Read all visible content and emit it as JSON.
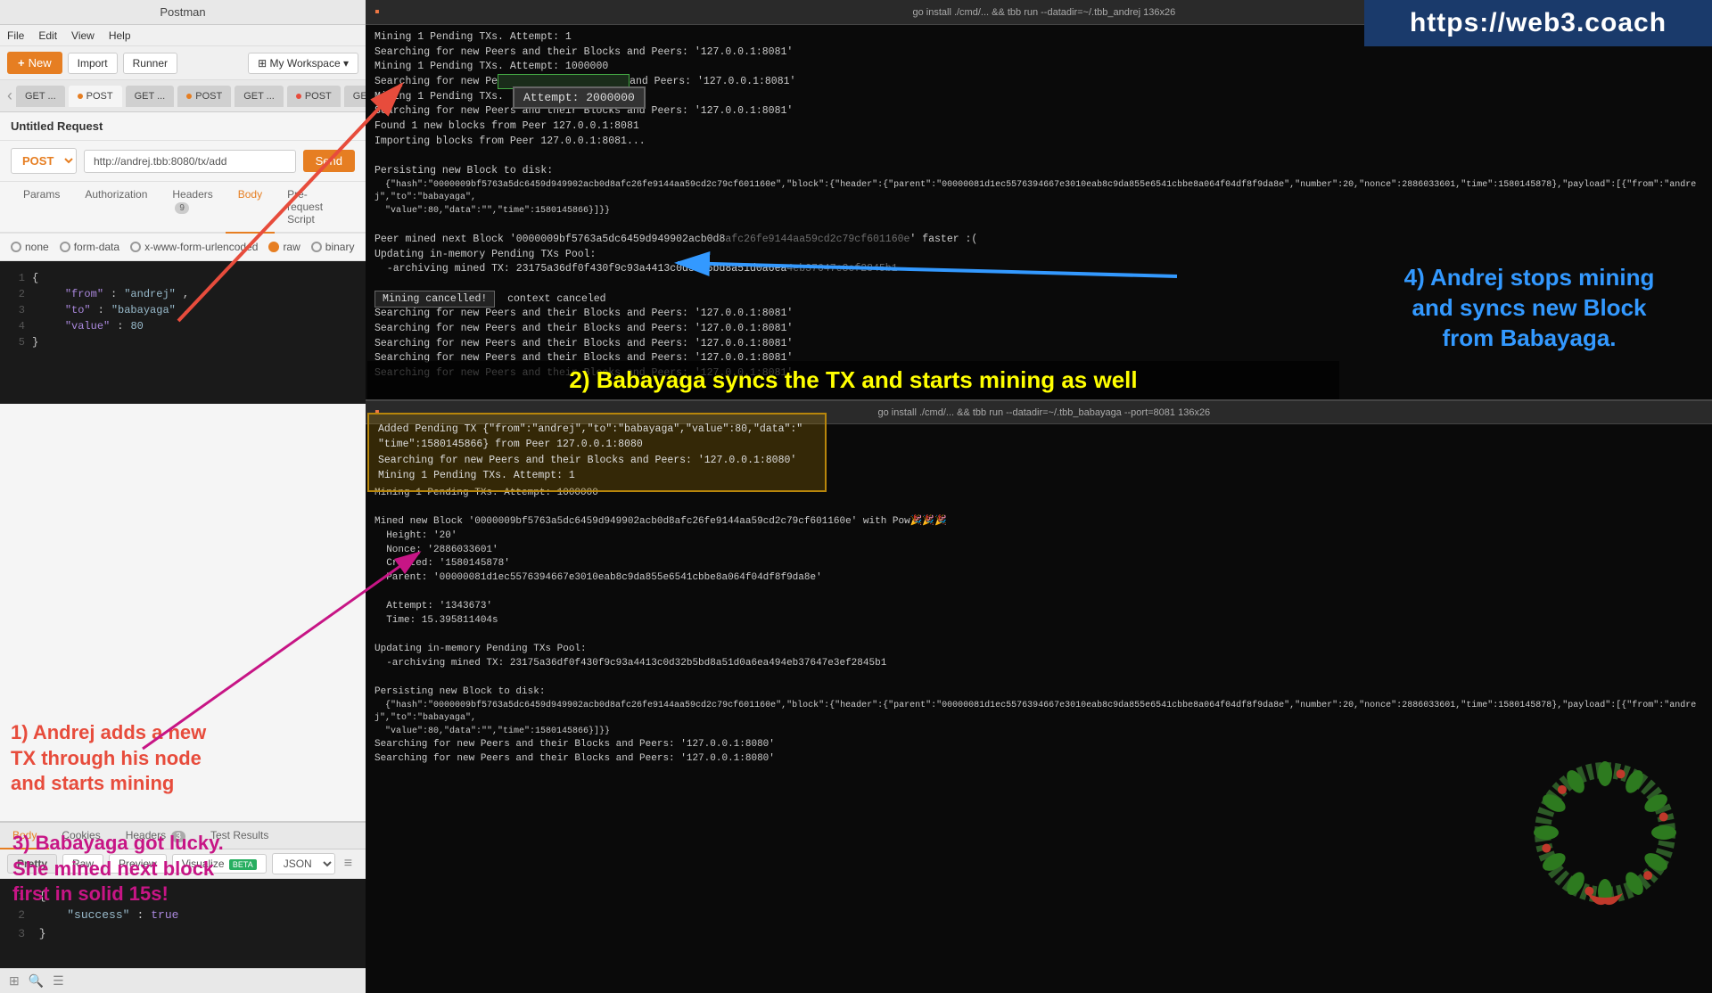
{
  "postman": {
    "titlebar": "Postman",
    "menu": [
      "File",
      "Edit",
      "View",
      "Help"
    ],
    "toolbar": {
      "new_label": "New",
      "import_label": "Import",
      "runner_label": "Runner",
      "workspace_label": "My Workspace"
    },
    "tabs": [
      {
        "label": "GET ...",
        "dot": "none"
      },
      {
        "label": "POST",
        "dot": "orange"
      },
      {
        "label": "GET ...",
        "dot": "none"
      },
      {
        "label": "POST",
        "dot": "orange"
      },
      {
        "label": "GET ...",
        "dot": "none"
      },
      {
        "label": "POST",
        "dot": "orange"
      },
      {
        "label": "GET ...",
        "dot": "none"
      }
    ],
    "request": {
      "title": "Untitled Request",
      "method": "POST",
      "url": "http://andrej.tbb:8080/tx/add",
      "subtabs": [
        "Params",
        "Authorization",
        "Headers (9)",
        "Body",
        "Pre-request Script"
      ],
      "body_options": [
        "none",
        "form-data",
        "x-www-form-urlencoded",
        "raw",
        "binary"
      ],
      "selected_body_option": "raw",
      "body_code": [
        "1  {",
        "2      \"from\": \"andrej\",",
        "3      \"to\": \"babayaga\",",
        "4      \"value\": 80",
        "5  }"
      ]
    },
    "response": {
      "tabs": [
        "Body",
        "Cookies",
        "Headers (3)",
        "Test Results"
      ],
      "toolbar_btns": [
        "Pretty",
        "Raw",
        "Preview",
        "Visualize BETA"
      ],
      "format": "JSON",
      "code": [
        "1  {",
        "2      \"success\": true",
        "3  }"
      ]
    }
  },
  "terminal_top": {
    "titlebar": "go install ./cmd/... && tbb run --datadir=~/.tbb_andrej 136x26",
    "content_lines": [
      "Mining 1 Pending TXs. Attempt: 1",
      "Searching for new Peers and their Blocks and Peers: '127.0.0.1:8081'",
      "Mining 1 Pending TXs. Attempt: 1000000",
      "Searching for new Peers and their Blocks and Peers: '127.0.0.1:8081'",
      "Mining 1 Pending TXs. Attempt: 2000000",
      "Searching for new Peers and their Blocks and Peers: '127.0.0.1:8081'",
      "Found 1 new blocks from Peer 127.0.0.1:8081",
      "Importing blocks from Peer 127.0.0.1:8081...",
      "",
      "Persisting new Block to disk:",
      "  {\"hash\":\"0000009bf5763a5dc6459d949902acb0d8afc26fe9144aa59cd2c79cf601160e\",\"block\":{\"header\":{\"parent\":\"00000081d1ec5576394667e3010eab8c9da855e6541cbbe8a064f04df8f9da8e\",\"number\":20,\"nonce\":2886033601,\"time\":1580145878},\"payload\":[{\"from\":\"andrej\",\"to\":\"babayaga\",",
      "  \"value\":80,\"data\":\"\",\"time\":1580145866}]}}",
      "",
      "Peer mined next Block '0000009bf5763a5dc6459d949902acb0d8afc26fe9144aa59cd2c79cf601160e' faster :(",
      "Updating in-memory Pending TXs Pool:",
      "  -archiving mined TX: 23175a36df0f430f9c93a4413c0d32b5bd8a51d0a6ea4eb37647e3ef2845b1",
      "",
      "Mining cancelled. context canceled",
      "Searching for new Peers and their Blocks and Peers: '127.0.0.1:8081'",
      "Searching for new Peers and their Blocks and Peers: '127.0.0.1:8081'",
      "Searching for new Peers and their Blocks and Peers: '127.0.0.1:8081'",
      "Searching for new Peers and their Blocks and Peers: '127.0.0.1:8081'",
      "Searching for new Peers and their Blocks and Peers: '127.0.0.1:8081'"
    ],
    "attempt_box": "Attempt: 2000000",
    "mining_cancelled_box": "Mining cancelled!"
  },
  "terminal_bottom": {
    "titlebar": "go install ./cmd/... && tbb run --datadir=~/.tbb_babayaga --port=8081 136x26",
    "pending_tx_lines": [
      "Added Pending TX {\"from\":\"andrej\",\"to\":\"babayaga\",\"value\":80,\"data\":\"  \"time\":1580145866} from Peer 127.0.0.1:8080",
      "Searching for new Peers and their Blocks and Peers: '127.0.0.1:8080'",
      "Mining 1 Pending TXs. Attempt: 1"
    ],
    "content_lines": [
      "Mining 1 Pending TXs. Attempt: 1000000",
      "",
      "Mined new Block '0000009bf5763a5dc6459d949902acb0d8afc26fe9144aa59cd2c79cf601160e' with Pow🎉🎉🎉",
      "  Height: '20'",
      "  Nonce: '2886033601'",
      "  Created: '1580145878'",
      "  Parent: '00000081d1ec5576394667e3010eab8c9da855e6541cbbe8a064f04df8f9da8e'",
      "",
      "  Attempt: '1343673'",
      "  Time: 15.395811404s",
      "",
      "Updating in-memory Pending TXs Pool:",
      "  -archiving mined TX: 23175a36df0f430f9c93a4413c0d32b5bd8a51d0a6ea494eb37647e3ef2845b1",
      "",
      "Persisting new Block to disk:",
      "  {\"hash\":\"0000009bf5763a5dc6459d949902acb0d8afc26fe9144aa59cd2c79cf601160e\",\"block\":{\"header\":{\"parent\":\"00000081d1ec5576394667e3010eab8c9da855e6541cbbe8a064f04df8f9da8e\",\"number\":20,\"nonce\":2886033601,\"time\":1580145878},\"payload\":[{\"from\":\"andrej\",\"to\":\"babayaga\",",
      "  \"value\":80,\"data\":\"\",\"time\":1580145866}]}}",
      "Searching for new Peers and their Blocks and Peers: '127.0.0.1:8080'",
      "Searching for new Peers and their Blocks and Peers: '127.0.0.1:8080'"
    ]
  },
  "annotations": {
    "ann1_line1": "1) Andrej adds a new",
    "ann1_line2": "TX through his node",
    "ann1_line3": "and starts mining",
    "ann2": "2) Babayaga syncs the TX and starts mining as well",
    "ann3_line1": "3) Babayaga got lucky.",
    "ann3_line2": "She mined next block",
    "ann3_line3": "first in solid 15s!",
    "ann4_line1": "4) Andrej stops mining",
    "ann4_line2": "and syncs new Block",
    "ann4_line3": "from Babayaga.",
    "web3coach": "https://web3.coach"
  }
}
